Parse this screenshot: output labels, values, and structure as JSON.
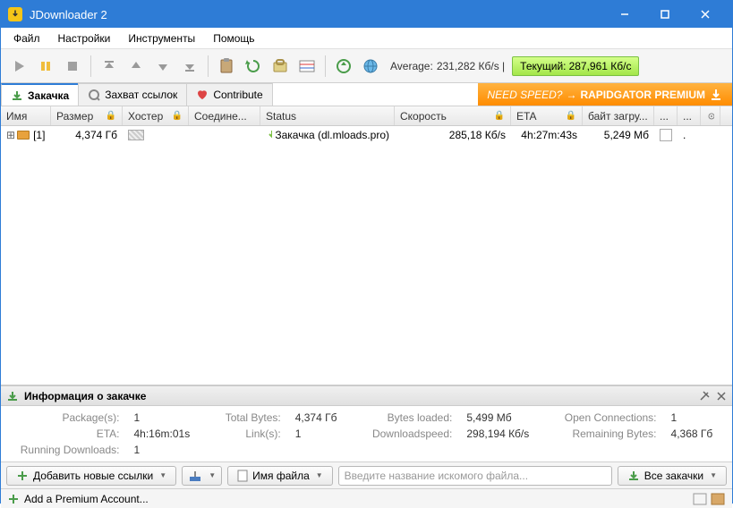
{
  "window": {
    "title": "JDownloader 2"
  },
  "menubar": [
    "Файл",
    "Настройки",
    "Инструменты",
    "Помощь"
  ],
  "speed": {
    "avg_label": "Average:",
    "avg_value": "231,282 Кб/s |",
    "current_label": "Текущий:",
    "current_value": "287,961 Кб/с"
  },
  "tabs": [
    {
      "label": "Закачка",
      "icon": "download-icon"
    },
    {
      "label": "Захват ссылок",
      "icon": "linkgrabber-icon"
    },
    {
      "label": "Contribute",
      "icon": "heart-icon"
    }
  ],
  "promo": {
    "need": "NEED SPEED?",
    "arrow": "→",
    "rapid": "RAPIDGATOR PREMIUM"
  },
  "columns": {
    "name": "Имя",
    "size": "Размер",
    "hoster": "Хостер",
    "conn": "Соедине...",
    "status": "Status",
    "speed": "Скорость",
    "eta": "ETA",
    "loaded": "байт загру...",
    "blank": "...",
    "dots": "..."
  },
  "rows": [
    {
      "name": "[1]",
      "size": "4,374 Гб",
      "status": "Закачка (dl.mloads.pro)",
      "speed": "285,18 Кб/s",
      "eta": "4h:27m:43s",
      "loaded": "5,249 Мб",
      "running": "."
    }
  ],
  "info": {
    "title": "Информация о закачке",
    "packages_lbl": "Package(s):",
    "packages_val": "1",
    "total_lbl": "Total Bytes:",
    "total_val": "4,374 Гб",
    "loaded_lbl": "Bytes loaded:",
    "loaded_val": "5,499 Мб",
    "eta_lbl": "ETA:",
    "eta_val": "4h:16m:01s",
    "openconn_lbl": "Open Connections:",
    "openconn_val": "1",
    "links_lbl": "Link(s):",
    "links_val": "1",
    "dlspeed_lbl": "Downloadspeed:",
    "dlspeed_val": "298,194 Кб/s",
    "remain_lbl": "Remaining Bytes:",
    "remain_val": "4,368 Гб",
    "running_lbl": "Running Downloads:",
    "running_val": "1"
  },
  "bottom": {
    "add_links": "Добавить новые ссылки",
    "filename_btn": "Имя файла",
    "search_placeholder": "Введите название искомого файла...",
    "all_downloads": "Все закачки"
  },
  "statusbar": {
    "premium": "Add a Premium Account..."
  }
}
